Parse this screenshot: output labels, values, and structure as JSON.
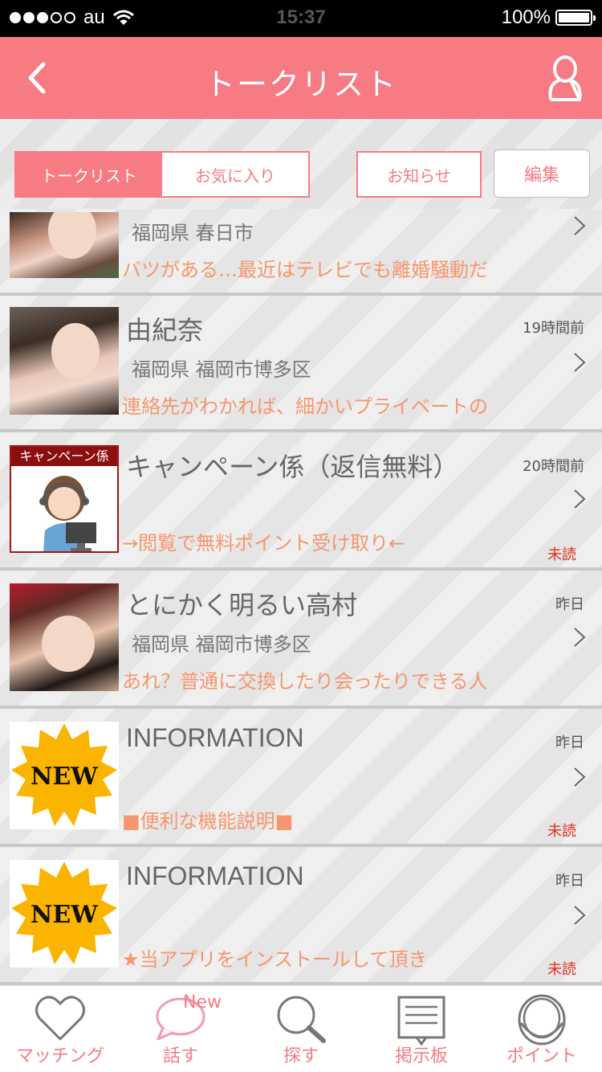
{
  "status_bar": {
    "carrier": "au",
    "time": "15:37",
    "battery": "100%"
  },
  "nav": {
    "title": "トークリスト"
  },
  "tabs": {
    "talk_list": "トークリスト",
    "favorites": "お気に入り",
    "notice": "お知らせ",
    "edit": "編集"
  },
  "rows": [
    {
      "name": "",
      "time": "",
      "location": "福岡県 春日市",
      "message": "バツがある…最近はテレビでも離婚騒動だ",
      "unread": ""
    },
    {
      "name": "由紀奈",
      "time": "19時間前",
      "location": "福岡県 福岡市博多区",
      "message": "連絡先がわかれば、細かいプライベートの",
      "unread": ""
    },
    {
      "name": "キャンペーン係（返信無料）",
      "time": "20時間前",
      "location": "",
      "message": "→閲覧で無料ポイント受け取り←",
      "unread": "未読",
      "avatar_label": "キャンペーン係"
    },
    {
      "name": "とにかく明るい高村",
      "time": "昨日",
      "location": "福岡県 福岡市博多区",
      "message": "あれ？普通に交換したり会ったりできる人",
      "unread": ""
    },
    {
      "name": "INFORMATION",
      "time": "昨日",
      "location": "",
      "message": "■便利な機能説明■",
      "unread": "未読",
      "avatar_label": "NEW"
    },
    {
      "name": "INFORMATION",
      "time": "昨日",
      "location": "",
      "message": "★当アプリをインストールして頂き",
      "unread": "未読",
      "avatar_label": "NEW"
    }
  ],
  "tab_bar": {
    "matching": "マッチング",
    "talk": "話す",
    "talk_badge": "New",
    "search": "探す",
    "board": "掲示板",
    "point": "ポイント"
  },
  "colors": {
    "accent": "#f67b82",
    "message": "#f6966e",
    "unread": "#e2301d"
  }
}
